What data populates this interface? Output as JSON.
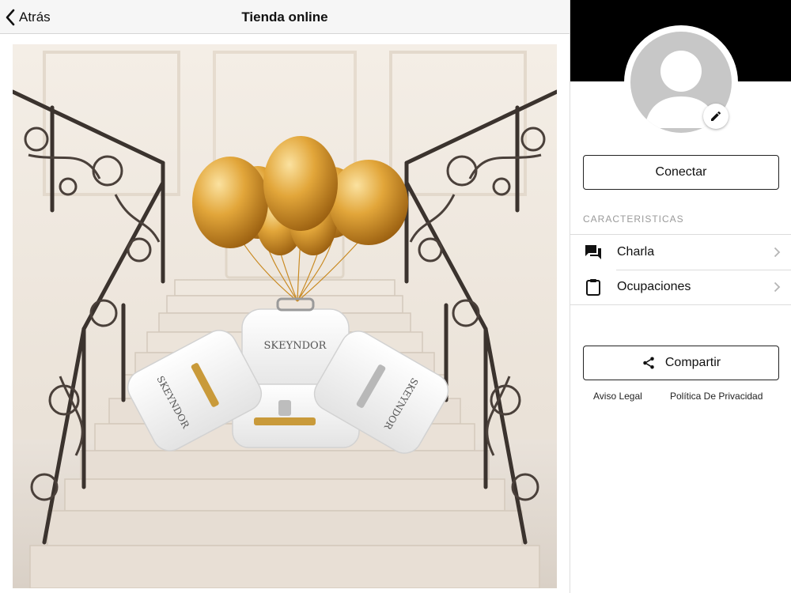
{
  "navbar": {
    "back_label": "Atrás",
    "title": "Tienda online"
  },
  "hero": {
    "brand_text": "SKEYNDOR"
  },
  "profile": {
    "connect_label": "Conectar"
  },
  "characteristics": {
    "header": "CARACTERISTICAS",
    "items": [
      {
        "label": "Charla",
        "icon": "chat-icon"
      },
      {
        "label": "Ocupaciones",
        "icon": "clipboard-icon"
      }
    ]
  },
  "share": {
    "label": "Compartir",
    "icon": "share-icon"
  },
  "footer": {
    "legal": "Aviso Legal",
    "privacy": "Política De Privacidad"
  },
  "colors": {
    "cover": "#000000",
    "avatar_placeholder": "#c7c7c7",
    "balloon_gold": "#d89a2a"
  }
}
